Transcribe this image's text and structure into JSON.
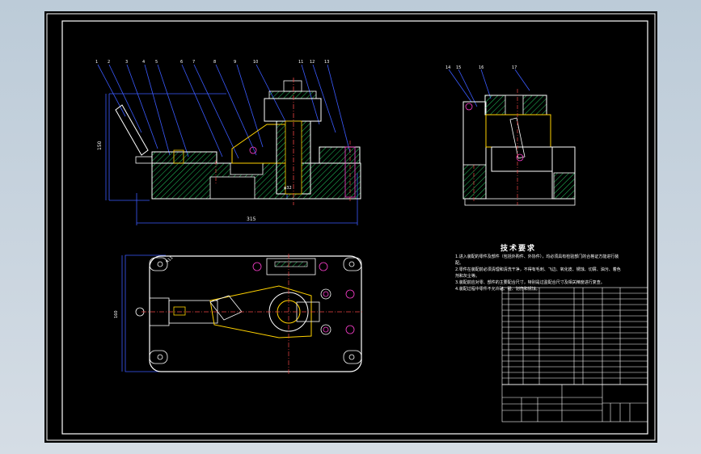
{
  "drawing": {
    "technical_requirements": {
      "title": "技术要求",
      "lines": [
        "1.进入装配的零件及部件（包括外购件、外协件），均必须具有检验部门的合格证方能进行装",
        "配。",
        "2.零件在装配前必须清理和清洗干净，不得有毛刺、飞边、氧化皮、锈蚀、切屑、油污、着色",
        "剂和灰尘等。",
        "3.装配前应对零、部件的主要配合尺寸，特别是过盈配合尺寸及相关精度进行复查。",
        "4.装配过程中零件不允许磕、碰、划伤和锈蚀。"
      ]
    },
    "dimensions": {
      "overall_length": "315",
      "height": "150",
      "center": "φ32",
      "plan_width": "160",
      "corner": "R11"
    },
    "balloons_front": [
      "1",
      "2",
      "3",
      "4",
      "5",
      "6",
      "7",
      "8",
      "9",
      "10",
      "11",
      "12",
      "13"
    ],
    "balloons_side": [
      "14",
      "15",
      "16",
      "17"
    ],
    "colors": {
      "outline": "#ffffff",
      "hatch": "#22c55e",
      "centerline": "#ef4444",
      "dimension": "#3b5bff",
      "yellow": "#facc15",
      "magenta": "#ff3fd0",
      "cyan": "#00e5ff",
      "background": "#000000"
    }
  }
}
